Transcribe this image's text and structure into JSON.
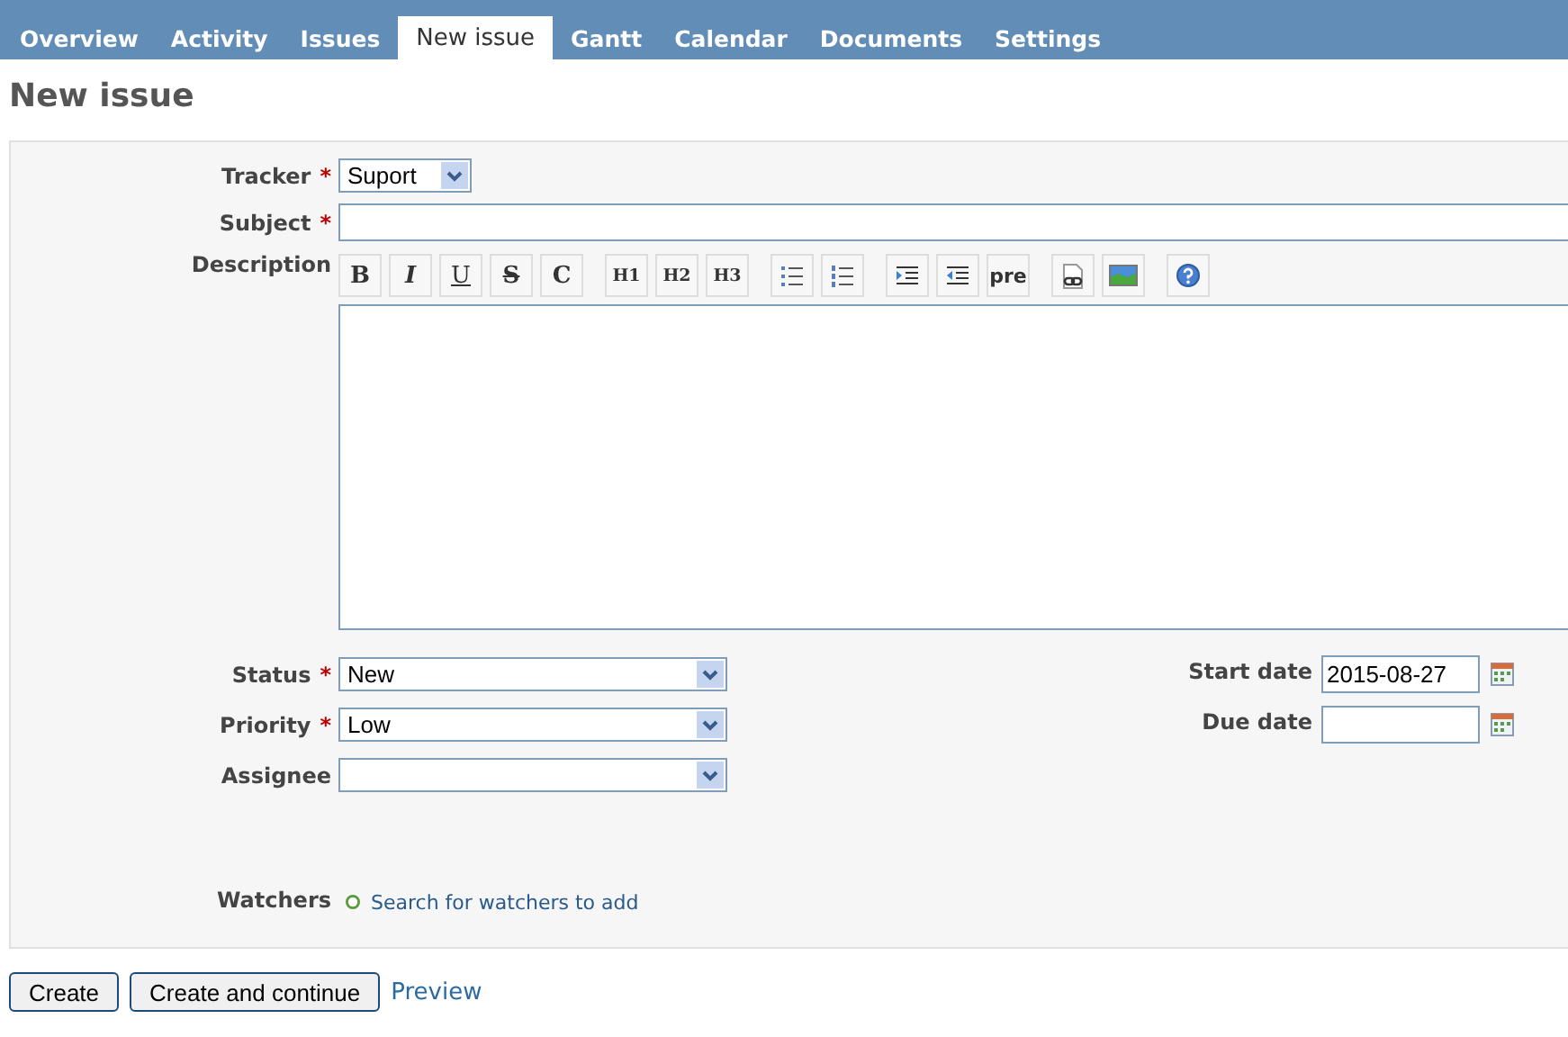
{
  "tabs": [
    {
      "label": "Overview",
      "selected": false
    },
    {
      "label": "Activity",
      "selected": false
    },
    {
      "label": "Issues",
      "selected": false
    },
    {
      "label": "New issue",
      "selected": true
    },
    {
      "label": "Gantt",
      "selected": false
    },
    {
      "label": "Calendar",
      "selected": false
    },
    {
      "label": "Documents",
      "selected": false
    },
    {
      "label": "Settings",
      "selected": false
    }
  ],
  "page_title": "New issue",
  "tracker": {
    "label": "Tracker",
    "mark": "*",
    "value": "Suport"
  },
  "subject": {
    "label": "Subject",
    "mark": "*"
  },
  "description": {
    "label": "Description",
    "toolbar": [
      [
        {
          "kind": "bold",
          "text": "B"
        },
        {
          "kind": "italic",
          "text": "I"
        },
        {
          "kind": "underline",
          "text": "U"
        },
        {
          "kind": "strike",
          "text": "S"
        },
        {
          "kind": "code",
          "text": "C"
        }
      ],
      [
        {
          "kind": "heading",
          "text": "H1"
        },
        {
          "kind": "heading",
          "text": "H2"
        },
        {
          "kind": "heading",
          "text": "H3"
        }
      ],
      [
        {
          "kind": "ul"
        },
        {
          "kind": "ol"
        }
      ],
      [
        {
          "kind": "indent"
        },
        {
          "kind": "outdent"
        },
        {
          "kind": "pre",
          "text": "pre"
        }
      ],
      [
        {
          "kind": "link"
        },
        {
          "kind": "image"
        }
      ],
      [
        {
          "kind": "help"
        }
      ]
    ]
  },
  "left_fields": [
    {
      "label": "Status",
      "mark": "*",
      "value": "New"
    },
    {
      "label": "Priority",
      "mark": "*",
      "value": "Low"
    },
    {
      "label": "Assignee"
    }
  ],
  "right_fields": [
    {
      "label": "Start date",
      "value": "2015-08-27"
    },
    {
      "label": "Due date"
    }
  ],
  "watchers": {
    "label": "Watchers",
    "link": "Search for watchers to add"
  },
  "buttons": [
    "Create",
    "Create and continue"
  ],
  "preview_link": "Preview"
}
